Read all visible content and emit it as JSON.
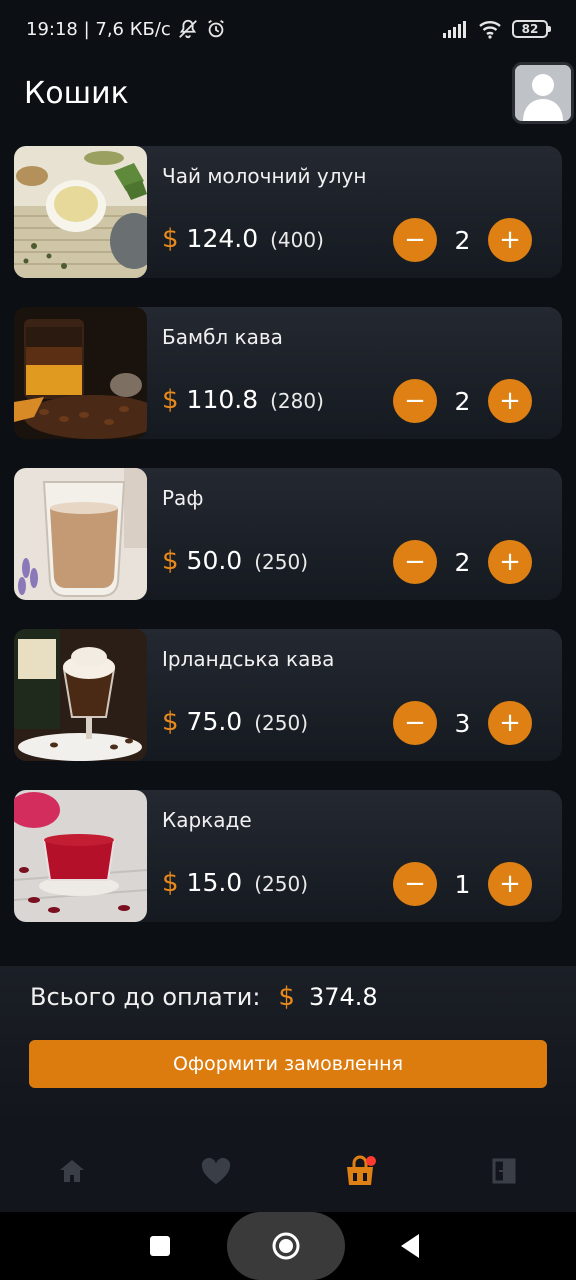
{
  "status_bar": {
    "time_speed": "19:18 | 7,6 КБ/с",
    "battery": "82"
  },
  "header": {
    "title": "Кошик"
  },
  "cart": {
    "items": [
      {
        "name": "Чай молочний улун",
        "currency": "$",
        "price": "124.0",
        "volume": "(400)",
        "quantity": "2"
      },
      {
        "name": "Бамбл кава",
        "currency": "$",
        "price": "110.8",
        "volume": "(280)",
        "quantity": "2"
      },
      {
        "name": "Раф",
        "currency": "$",
        "price": "50.0",
        "volume": "(250)",
        "quantity": "2"
      },
      {
        "name": "Ірландська кава",
        "currency": "$",
        "price": "75.0",
        "volume": "(250)",
        "quantity": "3"
      },
      {
        "name": "Каркаде",
        "currency": "$",
        "price": "15.0",
        "volume": "(250)",
        "quantity": "1"
      }
    ],
    "minus_label": "−",
    "plus_label": "+"
  },
  "summary": {
    "total_label": "Всього до оплати:",
    "currency": "$",
    "total_value": "374.8",
    "checkout_label": "Оформити замовлення"
  },
  "bottom_nav": {
    "items": [
      "home-icon",
      "heart-icon",
      "cart-icon",
      "logout-icon"
    ],
    "active": "cart-icon",
    "active_color": "#de8013",
    "inactive_color": "#3a3f47"
  },
  "colors": {
    "accent": "#de8013",
    "background": "#0c0f14",
    "badge": "#ff3b30"
  }
}
